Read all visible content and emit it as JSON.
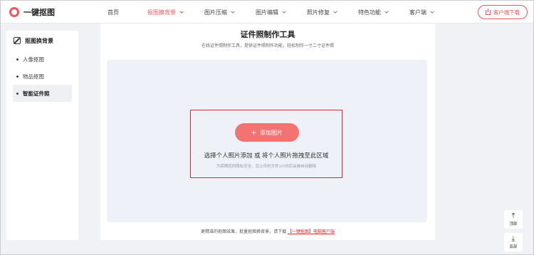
{
  "header": {
    "logo_text": "一键抠图",
    "nav": [
      {
        "label": "首页",
        "dropdown": false,
        "active": false
      },
      {
        "label": "抠图换背景",
        "dropdown": true,
        "active": true
      },
      {
        "label": "图片压缩",
        "dropdown": true,
        "active": false
      },
      {
        "label": "图片编辑",
        "dropdown": true,
        "active": false
      },
      {
        "label": "照片修复",
        "dropdown": true,
        "active": false
      },
      {
        "label": "特色功能",
        "dropdown": true,
        "active": false
      },
      {
        "label": "客户端",
        "dropdown": true,
        "active": false
      }
    ],
    "download_label": "客户端下载"
  },
  "sidebar": {
    "title": "抠图换背景",
    "items": [
      {
        "label": "人像抠图",
        "active": false
      },
      {
        "label": "物品抠图",
        "active": false
      },
      {
        "label": "智能证件照",
        "active": true
      }
    ]
  },
  "main": {
    "title": "证件照制作工具",
    "subtitle": "在线证件照制作工具，提供证件照制作功能，轻松制作一寸二寸证件照",
    "add_button_label": "添加图片",
    "drop_hint": "选择个人照片添加 或 将个人照片拖拽至此区域",
    "privacy_hint": "为保障您的隐私安全，您上传的文件1小时后会被自动删除",
    "footer_text": "更精准的抠图效果，批量抠图换背景，请下载",
    "footer_link": "【一键抠图】电脑客户端"
  },
  "floating": {
    "top_label": "顶部",
    "bottom_label": "底部"
  },
  "colors": {
    "accent": "#f2545b",
    "highlight_border": "#e0242d",
    "add_button": "#f37272"
  }
}
